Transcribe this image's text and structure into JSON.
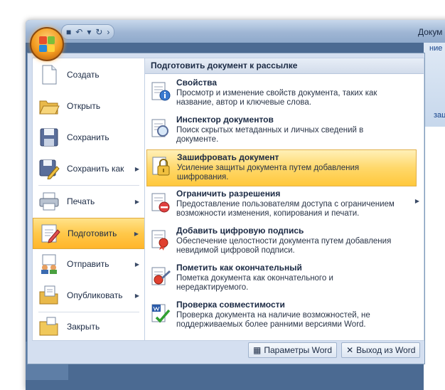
{
  "window": {
    "title": "Докум"
  },
  "ribbon": {
    "labels": [
      "ние",
      "зац"
    ]
  },
  "quick_access": {
    "items": [
      "save-icon",
      "undo-icon",
      "redo-icon"
    ]
  },
  "left_menu": [
    {
      "label": "Создать",
      "icon": "new-document-icon"
    },
    {
      "label": "Открыть",
      "icon": "open-folder-icon"
    },
    {
      "label": "Сохранить",
      "icon": "save-disk-icon"
    },
    {
      "label": "Сохранить как",
      "icon": "save-as-icon",
      "has_submenu": true
    },
    {
      "label": "Печать",
      "icon": "printer-icon",
      "has_submenu": true
    },
    {
      "label": "Подготовить",
      "icon": "prepare-icon",
      "has_submenu": true,
      "active": true
    },
    {
      "label": "Отправить",
      "icon": "send-icon",
      "has_submenu": true
    },
    {
      "label": "Опубликовать",
      "icon": "publish-icon",
      "has_submenu": true
    },
    {
      "label": "Закрыть",
      "icon": "close-folder-icon"
    }
  ],
  "right_pane": {
    "header": "Подготовить документ к рассылке",
    "items": [
      {
        "title": "Свойства",
        "desc": "Просмотр и изменение свойств документа, таких как название, автор и ключевые слова.",
        "icon": "properties-icon"
      },
      {
        "title": "Инспектор документов",
        "desc": "Поиск скрытых метаданных и личных сведений в документе.",
        "icon": "inspector-icon"
      },
      {
        "title": "Зашифровать документ",
        "desc": "Усиление защиты документа путем добавления шифрования.",
        "icon": "lock-icon",
        "active": true
      },
      {
        "title": "Ограничить разрешения",
        "desc": "Предоставление пользователям доступа с ограничением возможности изменения, копирования и печати.",
        "icon": "restrict-icon",
        "has_submenu": true
      },
      {
        "title": "Добавить цифровую подпись",
        "desc": "Обеспечение целостности документа путем добавления невидимой цифровой подписи.",
        "icon": "signature-icon"
      },
      {
        "title": "Пометить как окончательный",
        "desc": "Пометка документа как окончательного и нередактируемого.",
        "icon": "mark-final-icon"
      },
      {
        "title": "Проверка совместимости",
        "desc": "Проверка документа на наличие возможностей, не поддерживаемых более ранними версиями Word.",
        "icon": "compatibility-icon"
      }
    ]
  },
  "footer": {
    "options_label": "Параметры Word",
    "exit_label": "Выход из Word"
  }
}
